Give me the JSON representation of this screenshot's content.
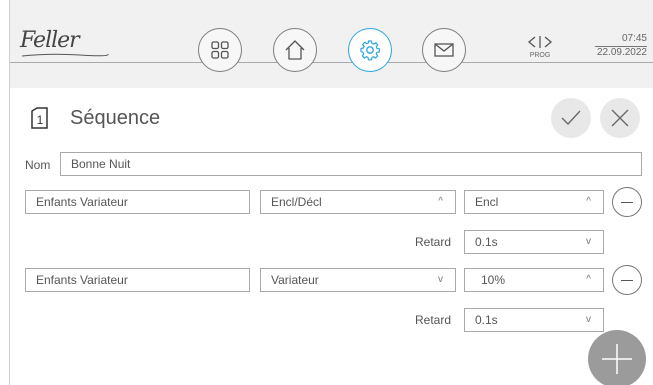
{
  "header": {
    "brand": "Feller",
    "prog_label": "PROG",
    "time": "07:45",
    "date": "22.09.2022",
    "nav": [
      {
        "icon": "grid-icon",
        "active": false
      },
      {
        "icon": "home-icon",
        "active": false
      },
      {
        "icon": "gear-icon",
        "active": true
      },
      {
        "icon": "mail-icon",
        "active": false
      }
    ],
    "accent_color": "#2aa6e0"
  },
  "page": {
    "number": "1",
    "title": "Séquence"
  },
  "form": {
    "name_label": "Nom",
    "name_value": "Bonne Nuit",
    "steps": [
      {
        "target": "Enfants Variateur",
        "action": "Encl/Décl",
        "value": "Encl",
        "delay_label": "Retard",
        "delay": "0.1s"
      },
      {
        "target": "Enfants Variateur",
        "action": "Variateur",
        "value": "10%",
        "delay_label": "Retard",
        "delay": "0.1s"
      }
    ]
  },
  "icons": {
    "chevron_up": "^",
    "chevron_down": "v"
  }
}
